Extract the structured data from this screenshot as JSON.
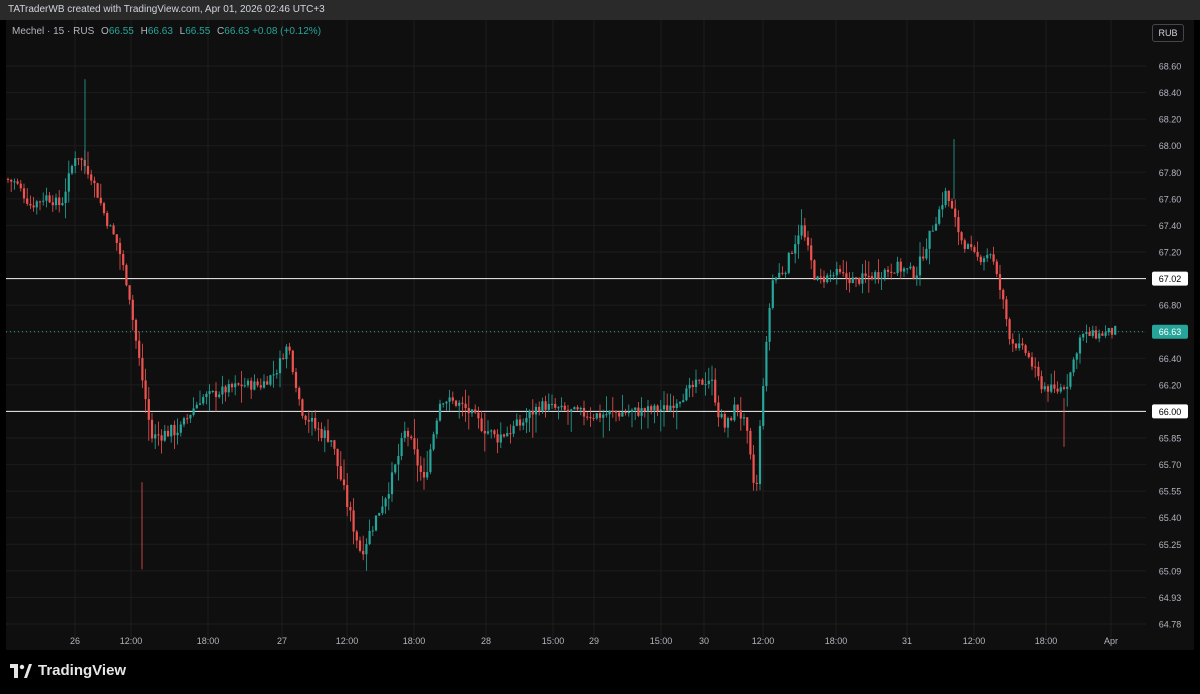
{
  "header": {
    "attribution": "TATraderWB created with TradingView.com, Apr 01, 2026 02:46 UTC+3"
  },
  "legend": {
    "symbol_info": "Mechel · 15 · RUS",
    "o_label": "O",
    "o_value": "66.55",
    "h_label": "H",
    "h_value": "66.63",
    "l_label": "L",
    "l_value": "66.55",
    "c_label": "C",
    "c_value": "66.63",
    "change": "+0.08 (+0.12%)"
  },
  "currency": "RUB",
  "logo": {
    "text": "TradingView",
    "icon": "tradingview-logo-icon"
  },
  "colors": {
    "up": "#26a69a",
    "down": "#ef5350",
    "background": "#0f0f0f",
    "level_line": "#d9d9d9",
    "price_line": "#26a69a"
  },
  "chart_data": {
    "type": "candlestick",
    "y_ticks": [
      "68.60",
      "68.40",
      "68.20",
      "68.00",
      "67.80",
      "67.60",
      "67.40",
      "67.20",
      "67.02",
      "66.80",
      "66.63",
      "66.40",
      "66.20",
      "66.00",
      "65.85",
      "65.70",
      "65.55",
      "65.40",
      "65.25",
      "65.09",
      "64.93",
      "64.78"
    ],
    "x_ticks": [
      "26",
      "12:00",
      "18:00",
      "27",
      "12:00",
      "18:00",
      "28",
      "15:00",
      "29",
      "15:00",
      "30",
      "12:00",
      "18:00",
      "31",
      "12:00",
      "18:00",
      "Apr"
    ],
    "horizontal_levels": [
      {
        "price": 67.02,
        "label": "67.02"
      },
      {
        "price": 66.0,
        "label": "66.00"
      }
    ],
    "last_price": {
      "price": 66.63,
      "label": "66.63"
    },
    "price_path": [
      [
        0,
        67.75
      ],
      [
        10,
        67.72
      ],
      [
        25,
        67.55
      ],
      [
        40,
        67.62
      ],
      [
        55,
        67.55
      ],
      [
        70,
        67.95
      ],
      [
        85,
        67.78
      ],
      [
        100,
        67.45
      ],
      [
        112,
        67.25
      ],
      [
        122,
        66.95
      ],
      [
        135,
        66.3
      ],
      [
        145,
        65.85
      ],
      [
        160,
        65.88
      ],
      [
        175,
        65.9
      ],
      [
        195,
        66.1
      ],
      [
        215,
        66.15
      ],
      [
        235,
        66.2
      ],
      [
        255,
        66.2
      ],
      [
        270,
        66.3
      ],
      [
        282,
        66.52
      ],
      [
        295,
        66.02
      ],
      [
        310,
        65.9
      ],
      [
        325,
        65.85
      ],
      [
        340,
        65.5
      ],
      [
        355,
        65.2
      ],
      [
        370,
        65.4
      ],
      [
        385,
        65.6
      ],
      [
        400,
        65.9
      ],
      [
        418,
        65.6
      ],
      [
        435,
        66.1
      ],
      [
        455,
        66.05
      ],
      [
        470,
        65.95
      ],
      [
        490,
        65.85
      ],
      [
        515,
        65.93
      ],
      [
        535,
        66.05
      ],
      [
        560,
        66.0
      ],
      [
        590,
        65.98
      ],
      [
        625,
        66.0
      ],
      [
        660,
        66.02
      ],
      [
        690,
        66.2
      ],
      [
        705,
        66.25
      ],
      [
        712,
        66.0
      ],
      [
        720,
        65.9
      ],
      [
        730,
        66.05
      ],
      [
        740,
        65.9
      ],
      [
        750,
        65.5
      ],
      [
        758,
        66.3
      ],
      [
        766,
        67.0
      ],
      [
        780,
        67.1
      ],
      [
        795,
        67.4
      ],
      [
        810,
        67.0
      ],
      [
        830,
        67.05
      ],
      [
        850,
        67.0
      ],
      [
        870,
        67.05
      ],
      [
        890,
        67.1
      ],
      [
        910,
        67.05
      ],
      [
        925,
        67.35
      ],
      [
        940,
        67.65
      ],
      [
        955,
        67.3
      ],
      [
        970,
        67.15
      ],
      [
        985,
        67.2
      ],
      [
        995,
        66.9
      ],
      [
        1005,
        66.55
      ],
      [
        1020,
        66.45
      ],
      [
        1035,
        66.2
      ],
      [
        1050,
        66.15
      ],
      [
        1062,
        66.22
      ],
      [
        1075,
        66.6
      ],
      [
        1090,
        66.6
      ],
      [
        1110,
        66.63
      ]
    ]
  }
}
